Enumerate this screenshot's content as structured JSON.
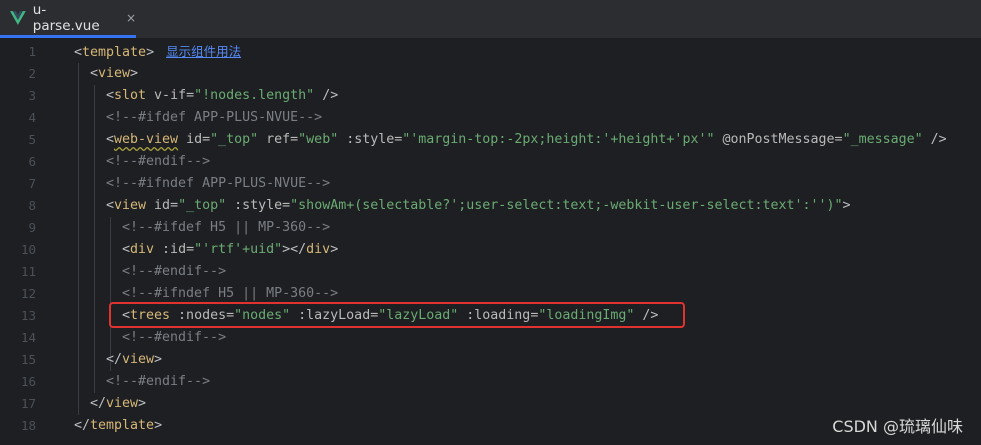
{
  "tab": {
    "title": "u-parse.vue",
    "close": "×"
  },
  "hint_link": "显示组件用法",
  "watermark": "CSDN @琉璃仙味",
  "line_numbers": [
    "1",
    "2",
    "3",
    "4",
    "5",
    "6",
    "7",
    "8",
    "9",
    "10",
    "11",
    "12",
    "13",
    "14",
    "15",
    "16",
    "17",
    "18"
  ],
  "code": {
    "l1": {
      "open": "<",
      "tag": "template",
      "close": ">"
    },
    "l2": {
      "open": "<",
      "tag": "view",
      "close": ">"
    },
    "l3": {
      "open": "<",
      "tag": "slot",
      "attr": " v-if=",
      "str": "\"!nodes.length\"",
      "close": " />"
    },
    "l4": {
      "comment": "<!--#ifdef APP-PLUS-NVUE-->"
    },
    "l5": {
      "open": "<",
      "tag": "web-view",
      "a1": " id=",
      "s1": "\"_top\"",
      "a2": " ref=",
      "s2": "\"web\"",
      "a3": " :style=",
      "s3": "\"'margin-top:-2px;height:'+height+'px'\"",
      "a4": " @onPostMessage=",
      "s4": "\"_message\"",
      "close": " />"
    },
    "l6": {
      "comment": "<!--#endif-->"
    },
    "l7": {
      "comment": "<!--#ifndef APP-PLUS-NVUE-->"
    },
    "l8": {
      "open": "<",
      "tag": "view",
      "a1": " id=",
      "s1": "\"_top\"",
      "a2": " :style=",
      "s2": "\"showAm+(selectable?';user-select:text;-webkit-user-select:text':'')\"",
      "close": ">"
    },
    "l9": {
      "comment": "<!--#ifdef H5 || MP-360-->"
    },
    "l10": {
      "open": "<",
      "tag": "div",
      "a1": " :id=",
      "s1": "\"'rtf'+uid\"",
      "close": "></",
      "tag2": "div",
      "close2": ">"
    },
    "l11": {
      "comment": "<!--#endif-->"
    },
    "l12": {
      "comment": "<!--#ifndef H5 || MP-360-->"
    },
    "l13": {
      "open": "<",
      "tag": "trees",
      "a1": " :nodes=",
      "s1": "\"nodes\"",
      "a2": " :lazyLoad=",
      "s2": "\"lazyLoad\"",
      "a3": " :loading=",
      "s3": "\"loadingImg\"",
      "close": " />"
    },
    "l14": {
      "comment": "<!--#endif-->"
    },
    "l15": {
      "open": "</",
      "tag": "view",
      "close": ">"
    },
    "l16": {
      "comment": "<!--#endif-->"
    },
    "l17": {
      "open": "</",
      "tag": "view",
      "close": ">"
    },
    "l18": {
      "open": "</",
      "tag": "template",
      "close": ">"
    }
  },
  "colors": {
    "tag": "#d5b778",
    "string": "#6aab73",
    "comment": "#7a7e85",
    "highlight": "#e0322f",
    "accent": "#3574f0"
  }
}
